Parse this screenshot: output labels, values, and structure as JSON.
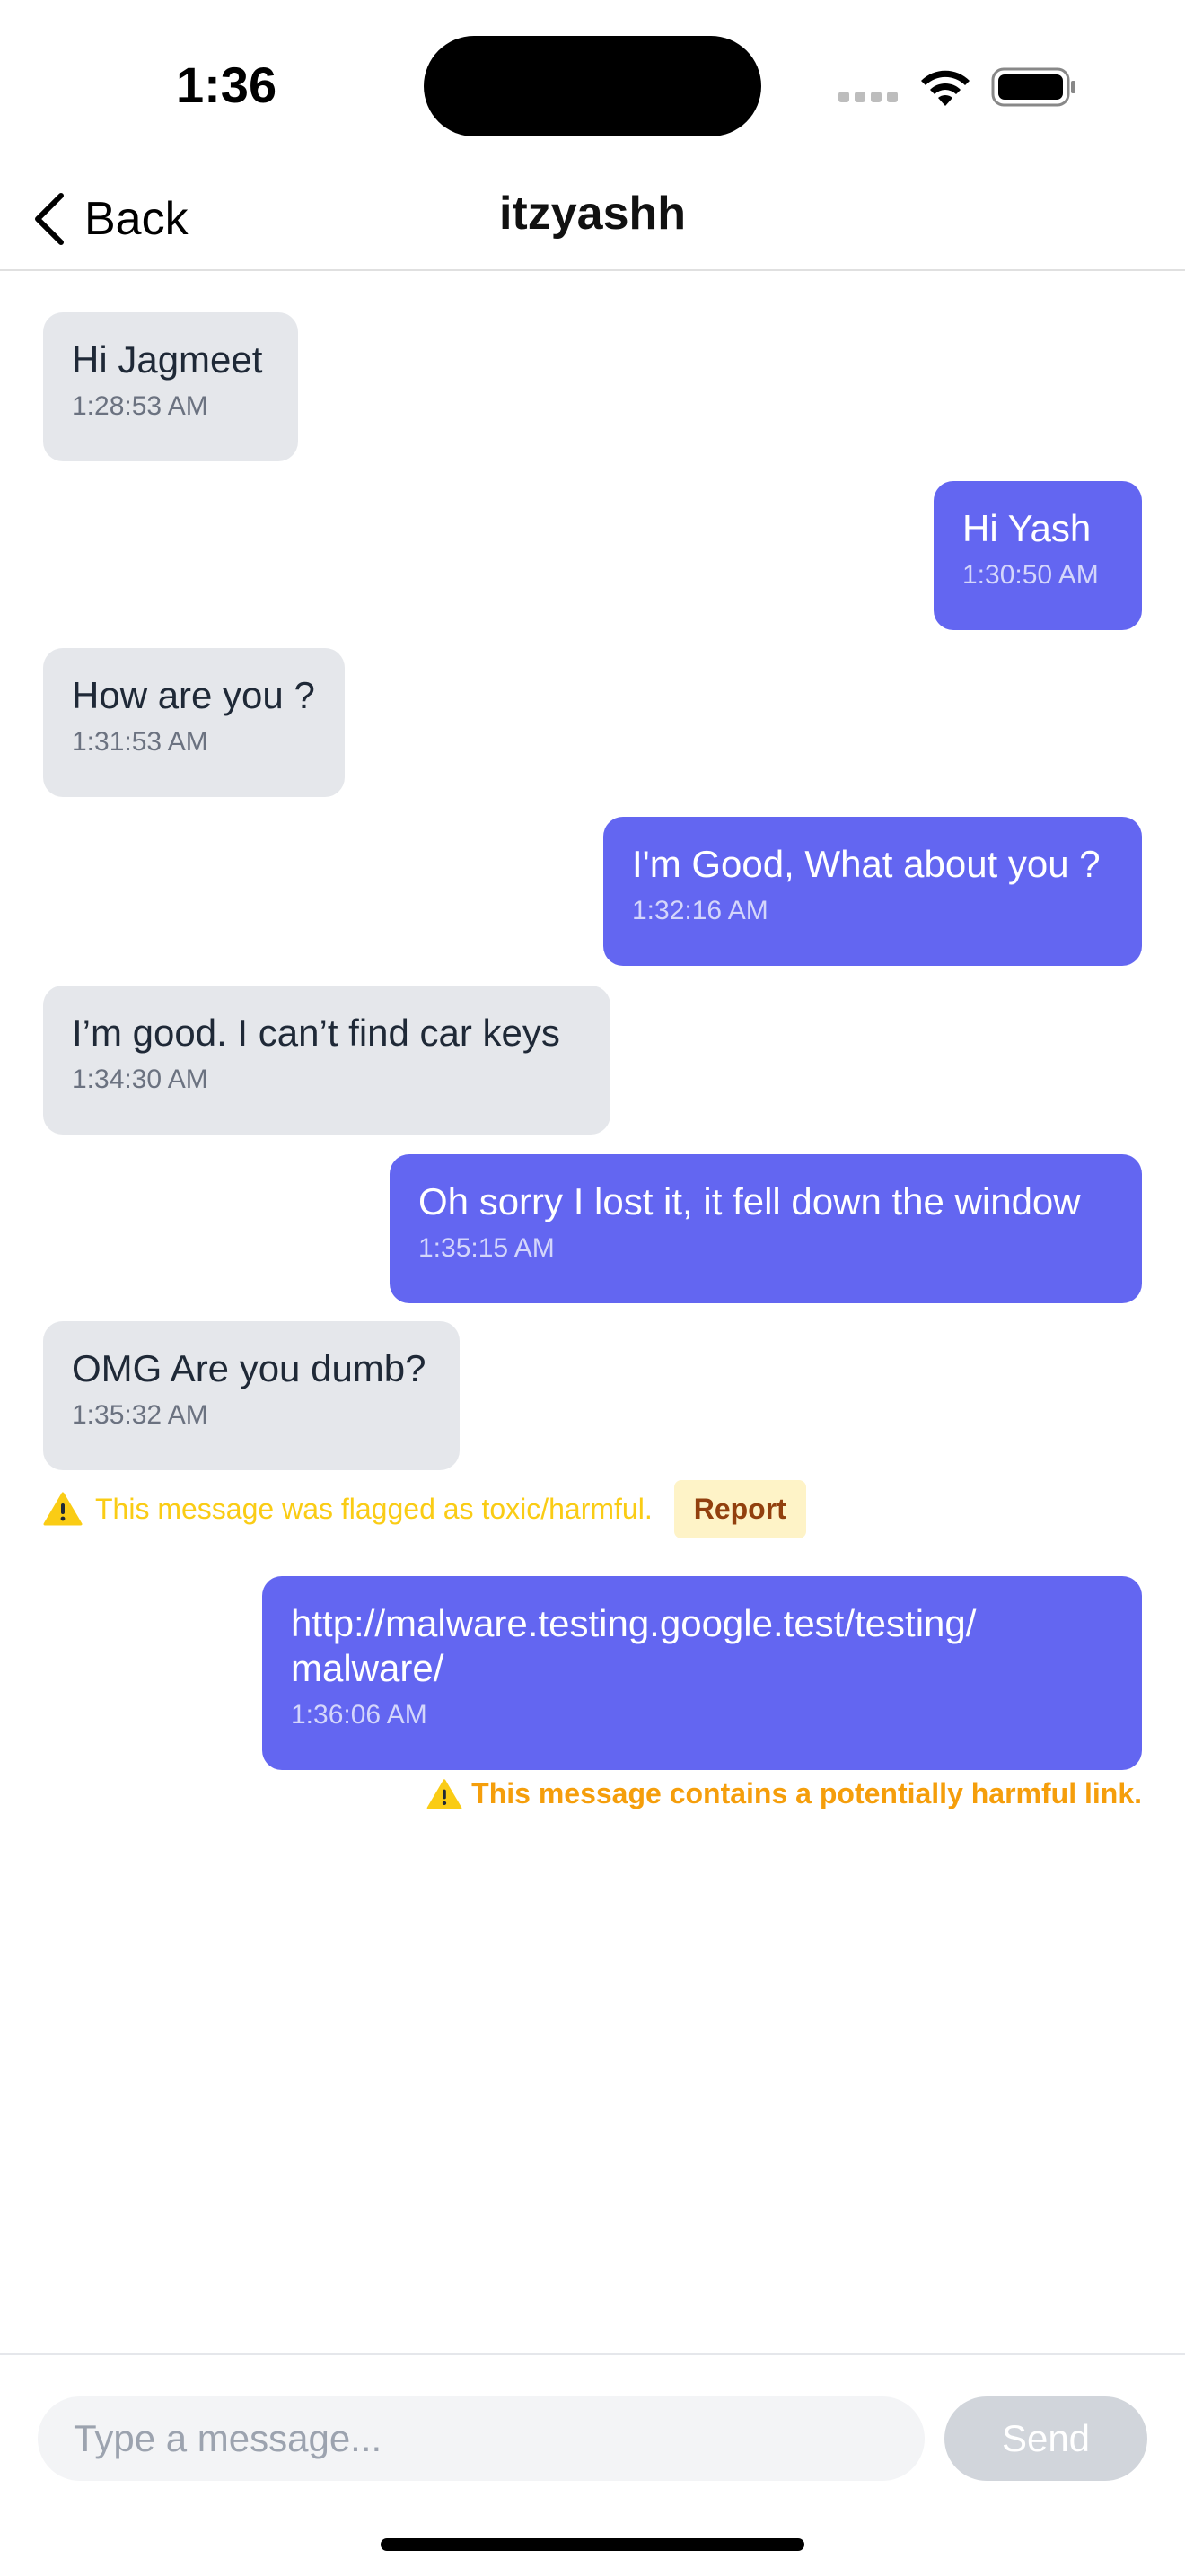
{
  "status_bar": {
    "time": "1:36"
  },
  "nav": {
    "back_label": "Back",
    "title": "itzyashh"
  },
  "messages": [
    {
      "direction": "in",
      "text": "Hi Jagmeet",
      "time": "1:28:53 AM"
    },
    {
      "direction": "out",
      "text": "Hi Yash",
      "time": "1:30:50 AM"
    },
    {
      "direction": "in",
      "text": "How are you ?",
      "time": "1:31:53 AM"
    },
    {
      "direction": "out",
      "text": "I'm Good, What about you ?",
      "time": "1:32:16 AM"
    },
    {
      "direction": "in",
      "text": "I’m good. I can’t find car keys",
      "time": "1:34:30 AM"
    },
    {
      "direction": "out",
      "text": "Oh sorry I lost it, it fell down the window",
      "time": "1:35:15 AM"
    },
    {
      "direction": "in",
      "text": "OMG Are you dumb?",
      "time": "1:35:32 AM"
    },
    {
      "direction": "out",
      "text": "http://malware.testing.google.test/testing/ malware/",
      "time": "1:36:06 AM"
    }
  ],
  "toxic_flag": {
    "text": "This message was flagged as toxic/harmful.",
    "report_label": "Report"
  },
  "link_warning": {
    "text": "This message contains a potentially harmful link."
  },
  "composer": {
    "placeholder": "Type a message...",
    "send_label": "Send"
  },
  "colors": {
    "outgoing_bubble": "#6366f1",
    "incoming_bubble": "#e5e7eb",
    "toxic_warning": "#facc15",
    "link_warning": "#f59e0b",
    "report_bg": "#fef3c7"
  }
}
